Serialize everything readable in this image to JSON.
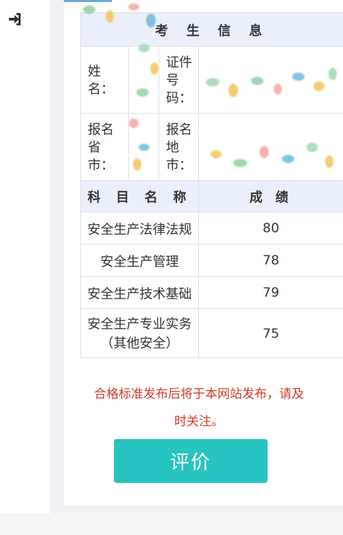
{
  "header": {
    "title": "考 生 信 息"
  },
  "candidate": {
    "name_label": "姓\n名：",
    "id_label": "证件\n号\n码：",
    "province_label": "报名\n省\n市：",
    "city_label": "报名\n地\n市："
  },
  "scores_header": {
    "subject": "科 目 名 称",
    "score": "成 绩"
  },
  "scores": [
    {
      "subject": "安全生产法律法规",
      "score": "80"
    },
    {
      "subject": "安全生产管理",
      "score": "78"
    },
    {
      "subject": "安全生产技术基础",
      "score": "79"
    },
    {
      "subject": "安全生产专业实务\n（其他安全）",
      "score": "75"
    }
  ],
  "notice": "合格标准发布后将于本网站发布，请及\n时关注。",
  "buttons": {
    "evaluate": "评价"
  },
  "colors": {
    "accent": "#28c4c2",
    "notice": "#d23a2a",
    "header_bg": "#e9f0fb"
  },
  "icons": {
    "login": "sign-in-icon"
  }
}
